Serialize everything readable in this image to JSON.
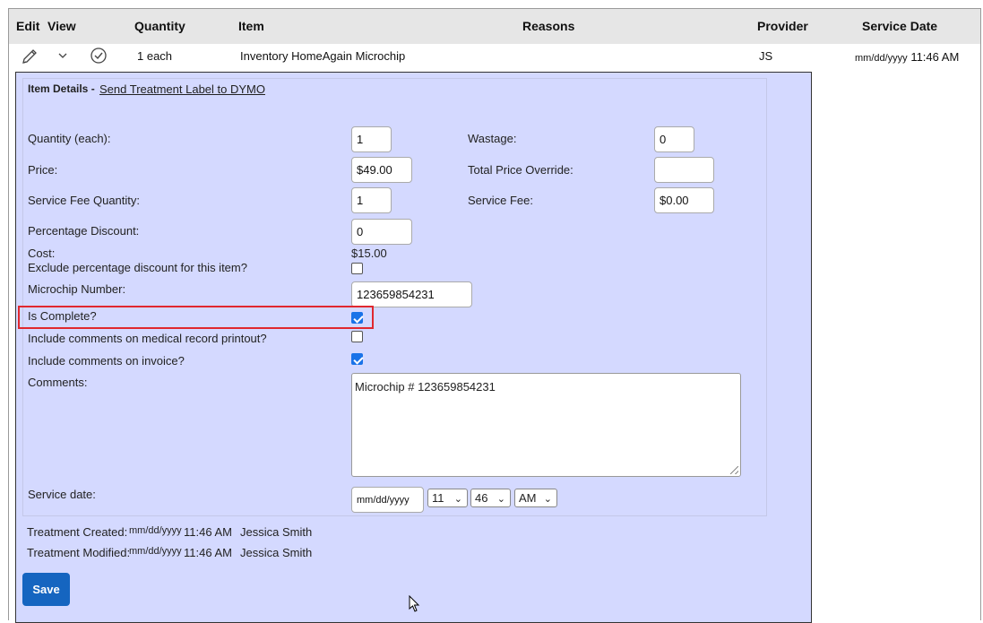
{
  "table": {
    "headers": {
      "edit": "Edit",
      "view": "View",
      "quantity": "Quantity",
      "item": "Item",
      "reasons": "Reasons",
      "provider": "Provider",
      "service_date": "Service Date"
    },
    "row": {
      "quantity": "1 each",
      "item": "Inventory HomeAgain Microchip",
      "provider": "JS",
      "service_date_placeholder": "mm/dd/yyyy",
      "service_time": "11:46 AM"
    }
  },
  "details": {
    "title": "Item Details -",
    "dymo_link": "Send Treatment Label to DYMO",
    "quantity_label": "Quantity (each):",
    "quantity_value": "1",
    "wastage_label": "Wastage:",
    "wastage_value": "0",
    "price_label": "Price:",
    "price_value": "$49.00",
    "total_override_label": "Total Price Override:",
    "total_override_value": "",
    "service_fee_qty_label": "Service Fee Quantity:",
    "service_fee_qty_value": "1",
    "service_fee_label": "Service Fee:",
    "service_fee_value": "$0.00",
    "pct_discount_label": "Percentage Discount:",
    "pct_discount_value": "0",
    "cost_label": "Cost:",
    "cost_value": "$15.00",
    "exclude_discount_label": "Exclude percentage discount for this item?",
    "exclude_discount_checked": false,
    "microchip_label": "Microchip Number:",
    "microchip_value": "123659854231",
    "is_complete_label": "Is Complete?",
    "is_complete_checked": true,
    "include_medical_label": "Include comments on medical record printout?",
    "include_medical_checked": false,
    "include_invoice_label": "Include comments on invoice?",
    "include_invoice_checked": true,
    "comments_label": "Comments:",
    "comments_value": "Microchip # 123659854231",
    "service_date_label": "Service date:",
    "service_date_placeholder": "mm/dd/yyyy",
    "hour_value": "11",
    "minute_value": "46",
    "ampm_value": "AM"
  },
  "audit": {
    "created_label": "Treatment Created:",
    "created_date": "mm/dd/yyyy",
    "created_time": "11:46 AM",
    "created_by": "Jessica Smith",
    "modified_label": "Treatment Modified:",
    "modified_date": "mm/dd/yyyy",
    "modified_time": "11:46 AM",
    "modified_by": "Jessica Smith"
  },
  "actions": {
    "save_label": "Save"
  },
  "icons": {
    "edit": "pencil-icon",
    "expand": "chevron-down-icon",
    "view": "check-circle-icon",
    "cursor": "mouse-pointer-icon"
  },
  "colors": {
    "panel_bg": "#d4d9ff",
    "save_button": "#1565c0",
    "highlight": "#e0282f",
    "checkbox_checked": "#1a73e8"
  }
}
